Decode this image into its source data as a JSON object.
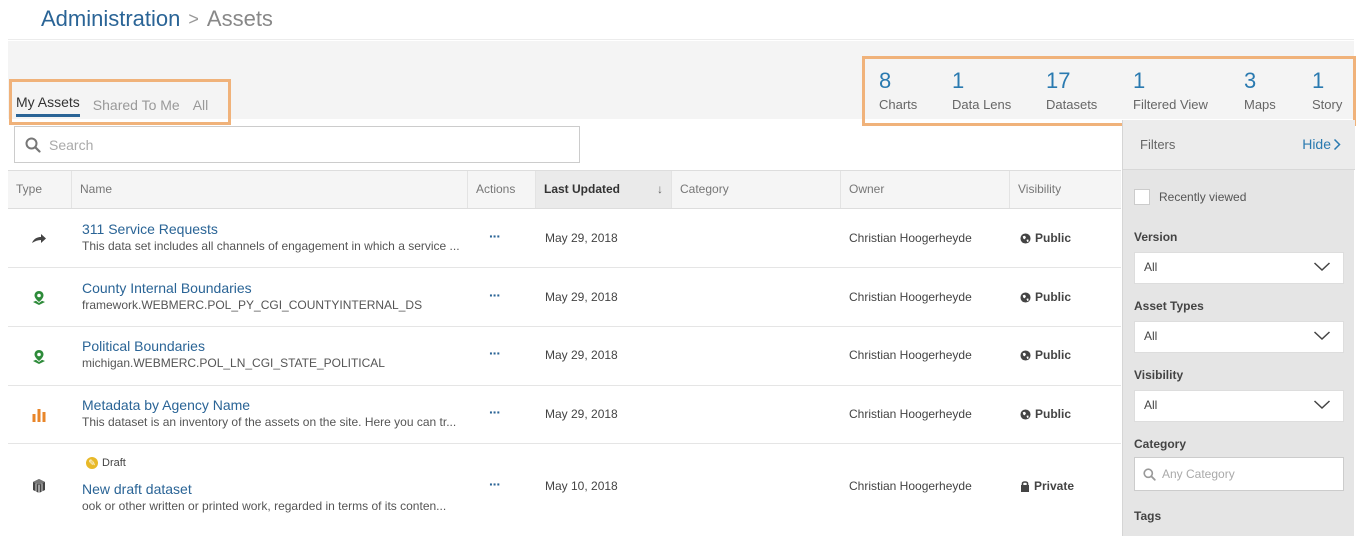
{
  "breadcrumb": {
    "parent": "Administration",
    "separator": ">",
    "current": "Assets"
  },
  "tabs": [
    {
      "label": "My Assets",
      "active": true
    },
    {
      "label": "Shared To Me",
      "active": false
    },
    {
      "label": "All",
      "active": false
    }
  ],
  "stats": [
    {
      "count": "8",
      "label": "Charts"
    },
    {
      "count": "1",
      "label": "Data Lens"
    },
    {
      "count": "17",
      "label": "Datasets"
    },
    {
      "count": "1",
      "label": "Filtered View"
    },
    {
      "count": "3",
      "label": "Maps"
    },
    {
      "count": "1",
      "label": "Story"
    }
  ],
  "search": {
    "placeholder": "Search",
    "value": ""
  },
  "table": {
    "columns": {
      "type": "Type",
      "name": "Name",
      "actions": "Actions",
      "last_updated": "Last Updated",
      "category": "Category",
      "owner": "Owner",
      "visibility": "Visibility"
    },
    "sort_column": "Last Updated",
    "sort_direction": "descending",
    "rows": [
      {
        "type_icon": "arrow-icon",
        "title": "311 Service Requests",
        "description": "This data set includes all channels of engagement in which a service ...",
        "actions": "···",
        "updated": "May 29, 2018",
        "category": "",
        "owner": "Christian Hoogerheyde",
        "visibility": "Public",
        "visibility_icon": "globe-icon"
      },
      {
        "type_icon": "map-pin-icon",
        "title": "County Internal Boundaries",
        "description": "framework.WEBMERC.POL_PY_CGI_COUNTYINTERNAL_DS",
        "actions": "···",
        "updated": "May 29, 2018",
        "category": "",
        "owner": "Christian Hoogerheyde",
        "visibility": "Public",
        "visibility_icon": "globe-icon"
      },
      {
        "type_icon": "map-pin-icon",
        "title": "Political Boundaries",
        "description": "michigan.WEBMERC.POL_LN_CGI_STATE_POLITICAL",
        "actions": "···",
        "updated": "May 29, 2018",
        "category": "",
        "owner": "Christian Hoogerheyde",
        "visibility": "Public",
        "visibility_icon": "globe-icon"
      },
      {
        "type_icon": "bar-chart-icon",
        "title": "Metadata by Agency Name",
        "description": "This dataset is an inventory of the assets on the site. Here you can tr...",
        "actions": "···",
        "updated": "May 29, 2018",
        "category": "",
        "owner": "Christian Hoogerheyde",
        "visibility": "Public",
        "visibility_icon": "globe-icon"
      },
      {
        "type_icon": "dataset-cube-icon",
        "badge": "Draft",
        "title": "New draft dataset",
        "description": "ook or other written or printed work, regarded in terms of its conten...",
        "actions": "···",
        "updated": "May 10, 2018",
        "category": "",
        "owner": "Christian Hoogerheyde",
        "visibility": "Private",
        "visibility_icon": "lock-icon"
      }
    ]
  },
  "sidebar": {
    "title": "Filters",
    "hide_label": "Hide",
    "recently_viewed": "Recently viewed",
    "version": {
      "label": "Version",
      "value": "All"
    },
    "asset_types": {
      "label": "Asset Types",
      "value": "All"
    },
    "visibility": {
      "label": "Visibility",
      "value": "All"
    },
    "category": {
      "label": "Category",
      "placeholder": "Any Category"
    },
    "tags": {
      "label": "Tags"
    }
  },
  "colors": {
    "accent": "#2a6496",
    "highlight_border": "#f0b27a",
    "map_green": "#2e8b3a",
    "chart_orange": "#e8862a",
    "draft_yellow": "#e8b928"
  }
}
